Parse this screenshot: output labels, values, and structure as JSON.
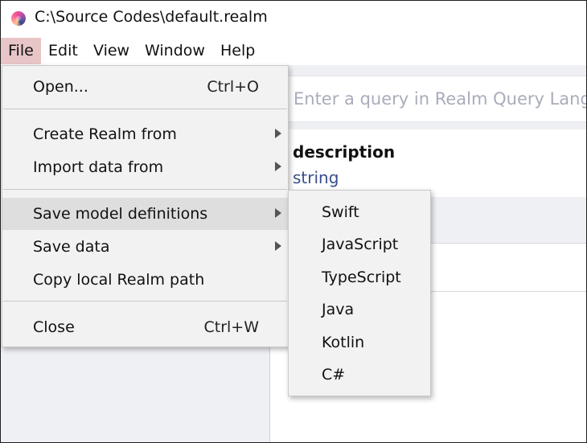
{
  "window": {
    "title": "C:\\Source Codes\\default.realm"
  },
  "menubar": {
    "items": [
      "File",
      "Edit",
      "View",
      "Window",
      "Help"
    ]
  },
  "file_menu": {
    "open": {
      "label": "Open...",
      "shortcut": "Ctrl+O"
    },
    "create_from": {
      "label": "Create Realm from"
    },
    "import_from": {
      "label": "Import data from"
    },
    "save_models": {
      "label": "Save model definitions"
    },
    "save_data": {
      "label": "Save data"
    },
    "copy_path": {
      "label": "Copy local Realm path"
    },
    "close": {
      "label": "Close",
      "shortcut": "Ctrl+W"
    }
  },
  "save_models_submenu": {
    "items": [
      "Swift",
      "JavaScript",
      "TypeScript",
      "Java",
      "Kotlin",
      "C#"
    ]
  },
  "main": {
    "query_placeholder": "Enter a query in Realm Query Language",
    "column": {
      "name": "description",
      "type": "string"
    }
  },
  "colors": {
    "menu_active": "#e8c5c7",
    "type_text": "#3a4d8c",
    "pane_bg": "#eff0f4"
  },
  "icons": {
    "app": "realm-logo-icon",
    "submenu_arrow": "chevron-right-icon"
  }
}
